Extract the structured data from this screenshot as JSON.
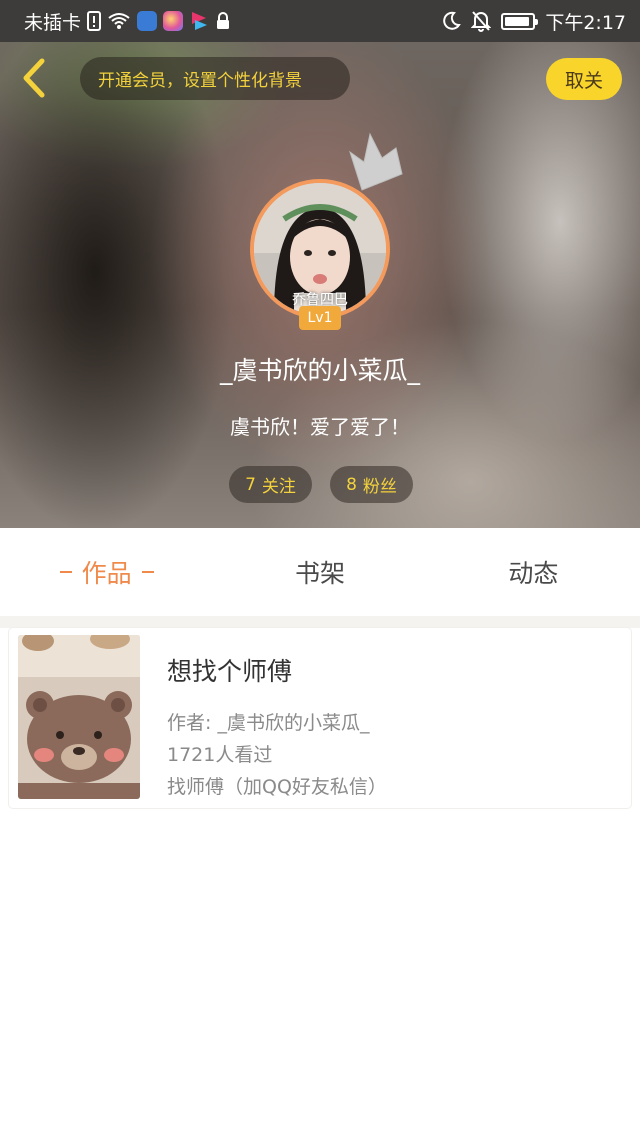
{
  "status_bar": {
    "carrier": "未插卡",
    "time": "下午2:17"
  },
  "header": {
    "vip_banner": "开通会员，设置个性化背景",
    "cancel_button": "取关"
  },
  "profile": {
    "avatar_caption": "乔鲁四巴",
    "level": "Lv1",
    "username": "_虞书欣的小菜瓜_",
    "signature": "虞书欣！爱了爱了！",
    "following": {
      "count": "7",
      "label": "关注"
    },
    "fans": {
      "count": "8",
      "label": "粉丝"
    }
  },
  "tabs": [
    {
      "label": "作品",
      "active": true
    },
    {
      "label": "书架",
      "active": false
    },
    {
      "label": "动态",
      "active": false
    }
  ],
  "works": [
    {
      "title": "想找个师傅",
      "author": "作者: _虞书欣的小菜瓜_",
      "views": "1721人看过",
      "desc": "找师傅（加QQ好友私信）"
    }
  ],
  "colors": {
    "accent_orange": "#f08a4b",
    "accent_yellow": "#f9d52b",
    "status_bar": "#3e3c3a"
  }
}
